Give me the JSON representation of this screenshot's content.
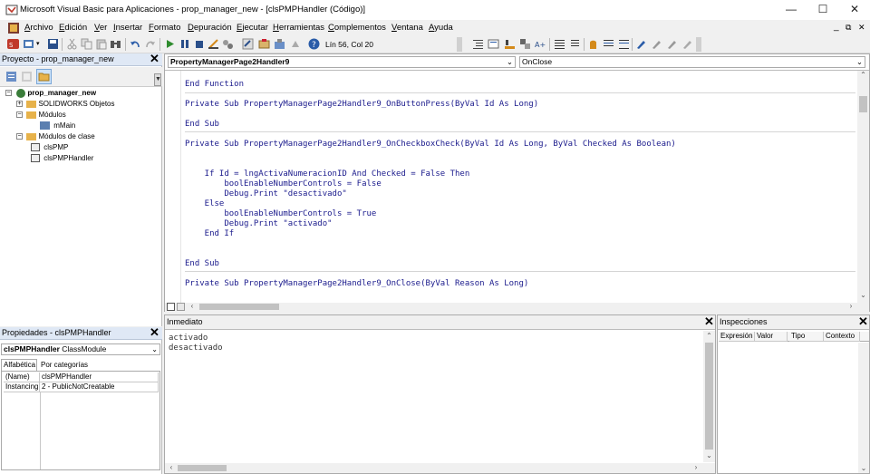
{
  "window": {
    "title": "Microsoft Visual Basic para Aplicaciones - prop_manager_new - [clsPMPHandler (Código)]",
    "minimize": "—",
    "maximize": "☐",
    "close": "✕"
  },
  "menu": {
    "items": [
      {
        "mn": "A",
        "rest": "rchivo"
      },
      {
        "mn": "E",
        "rest": "dición"
      },
      {
        "mn": "V",
        "rest": "er"
      },
      {
        "mn": "I",
        "rest": "nsertar"
      },
      {
        "mn": "F",
        "rest": "ormato"
      },
      {
        "mn": "D",
        "rest": "epuración"
      },
      {
        "mn": "E",
        "rest": "jecutar"
      },
      {
        "mn": "H",
        "rest": "erramientas"
      },
      {
        "mn": "C",
        "rest": "omplementos"
      },
      {
        "mn": "V",
        "rest": "entana"
      },
      {
        "mn": "A",
        "rest": "yuda"
      }
    ],
    "doc_controls": [
      "_",
      "⧉",
      "✕"
    ]
  },
  "toolbar": {
    "position": "Lín 56, Col 20"
  },
  "project": {
    "title": "Proyecto - prop_manager_new",
    "close": "✕",
    "tree": {
      "root": "prop_manager_new",
      "solidworks": "SOLIDWORKS Objetos",
      "modules": "Módulos",
      "mmain": "mMain",
      "class_modules": "Módulos de clase",
      "clspmp": "clsPMP",
      "clspmphandler": "clsPMPHandler"
    }
  },
  "properties": {
    "title": "Propiedades - clsPMPHandler",
    "close": "✕",
    "object_name": "clsPMPHandler",
    "object_type": "ClassModule",
    "tabs": [
      "Alfabética",
      "Por categorías"
    ],
    "rows": [
      {
        "name": "(Name)",
        "value": "clsPMPHandler"
      },
      {
        "name": "Instancing",
        "value": "2 - PublicNotCreatable"
      }
    ]
  },
  "code": {
    "object_combo": "PropertyManagerPage2Handler9",
    "proc_combo": "OnClose",
    "lines": [
      "End Function",
      "",
      "Private Sub PropertyManagerPage2Handler9_OnButtonPress(ByVal Id As Long)",
      "",
      "End Sub",
      "",
      "Private Sub PropertyManagerPage2Handler9_OnCheckboxCheck(ByVal Id As Long, ByVal Checked As Boolean)",
      "",
      "",
      "    If Id = lngActivaNumeracionID And Checked = False Then",
      "        boolEnableNumberControls = False",
      "        Debug.Print \"desactivado\"",
      "    Else",
      "        boolEnableNumberControls = True",
      "        Debug.Print \"activado\"",
      "    End If",
      "",
      "",
      "End Sub",
      "",
      "Private Sub PropertyManagerPage2Handler9_OnClose(ByVal Reason As Long)"
    ]
  },
  "immediate": {
    "title": "Inmediato",
    "close": "✕",
    "lines": [
      "activado",
      "desactivado"
    ]
  },
  "watches": {
    "title": "Inspecciones",
    "close": "✕",
    "columns": [
      "Expresión",
      "Valor",
      "Tipo",
      "Contexto"
    ]
  },
  "colors": {
    "code_text": "#1a1a8c",
    "pane_title_bg": "#dfe8f5"
  }
}
